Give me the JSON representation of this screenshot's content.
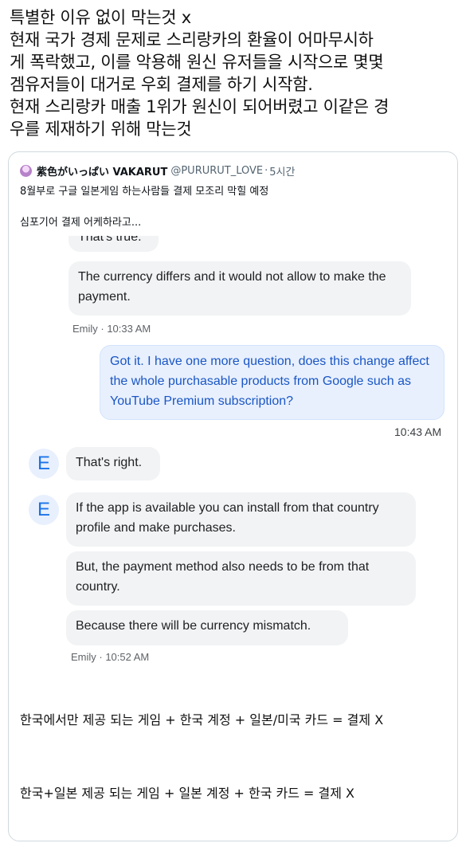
{
  "intro": {
    "lines": [
      "특별한 이유 없이 막는것 x",
      "현재 국가 경제 문제로 스리랑카의 환율이 어마무시하",
      "게 폭락했고, 이를 악용해 원신 유저들을 시작으로 몇몇",
      "겜유저들이 대거로 우회 결제를 하기 시작함.",
      "현재 스리랑카 매출 1위가 원신이 되어버렸고 이같은 경",
      "우를 제재하기 위해 막는것"
    ]
  },
  "tweet": {
    "avatar_icon": "avatar-icon",
    "name": "紫色がいっぱい VAKARUT",
    "handle": "@PURURUT_LOVE",
    "dot": "·",
    "time": "5시간",
    "text_line1": "8월부로 구글 일본게임 하는사람들 결제 모조리 막힐 예정",
    "text_line2": "심포기어 결제 어케하라고...",
    "chat": {
      "cut_message": "That's true.",
      "msg1": "The currency differs and it would not allow to make the payment.",
      "meta1": "Emily · 10:33 AM",
      "user_msg": "Got it. I have one more question, does this change affect the whole purchasable products from Google such as YouTube Premium subscription?",
      "user_time": "10:43 AM",
      "avatar_letter": "E",
      "msg2": "That's right.",
      "msg3": "If the app is available you can install from that country profile and make purchases.",
      "msg4": "But, the payment method also needs to be from that country.",
      "msg5": "Because there will be currency mismatch.",
      "meta2": "Emily · 10:52 AM"
    },
    "formula1": "한국에서만 제공 되는 게임 + 한국 계정 + 일본/미국 카드 = 결제 X",
    "formula2": "한국+일본 제공 되는 게임 + 일본 계정 + 한국 카드 = 결제 X"
  },
  "colors": {
    "agent_bubble": "#f1f3f4",
    "user_bubble": "#e8f0fe",
    "user_text": "#1a56c4",
    "avatar_letter": "#1a73e8"
  }
}
